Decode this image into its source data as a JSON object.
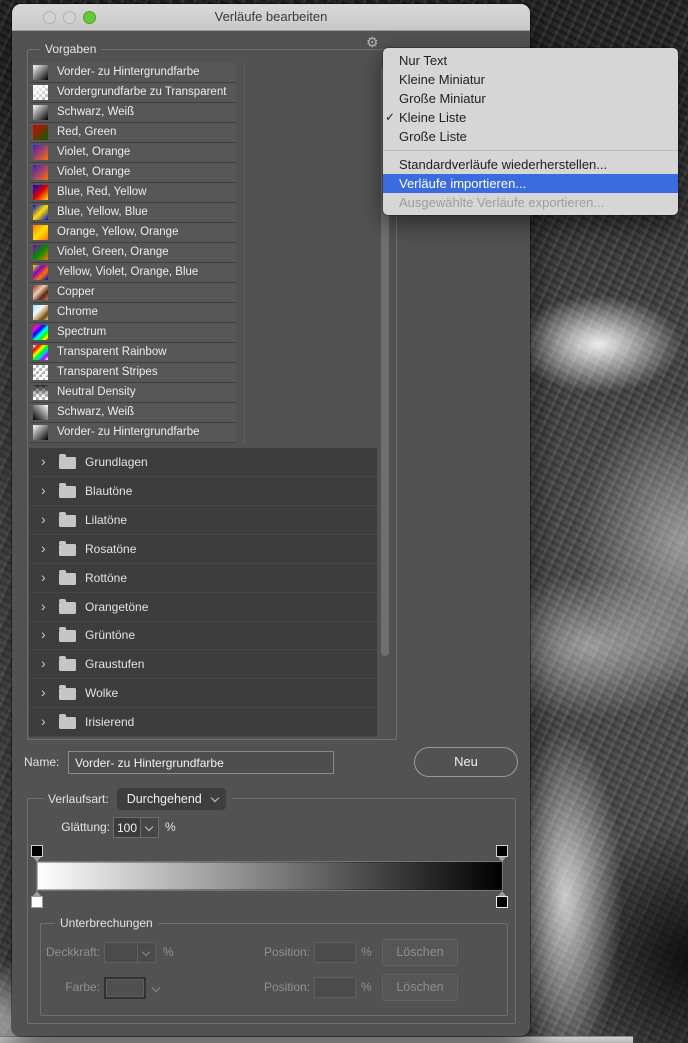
{
  "window": {
    "title": "Verläufe bearbeiten"
  },
  "presets": {
    "legend": "Vorgaben",
    "items": [
      {
        "name": "Vorder- zu Hintergrundfarbe",
        "thumb": "linear-gradient(135deg,#ffffff,#000000)",
        "transparent": false
      },
      {
        "name": "Vordergrundfarbe zu Transparent",
        "thumb": "linear-gradient(135deg,#ffffff,rgba(255,255,255,0))",
        "transparent": true
      },
      {
        "name": "Schwarz, Weiß",
        "thumb": "linear-gradient(135deg,#ffffff,#000000)",
        "transparent": false
      },
      {
        "name": "Red, Green",
        "thumb": "linear-gradient(135deg,#e00000,#006400)",
        "transparent": false
      },
      {
        "name": "Violet, Orange",
        "thumb": "linear-gradient(135deg,#4619c8,#ff7300)",
        "transparent": false
      },
      {
        "name": "Violet, Orange",
        "thumb": "linear-gradient(135deg,#4619c8,#ff7300)",
        "transparent": false
      },
      {
        "name": "Blue, Red, Yellow",
        "thumb": "linear-gradient(135deg,#0009d2,#e00000 50%,#ffe000)",
        "transparent": false
      },
      {
        "name": "Blue, Yellow, Blue",
        "thumb": "linear-gradient(135deg,#0009d2,#ffe000 50%,#0009d2)",
        "transparent": false
      },
      {
        "name": "Orange, Yellow, Orange",
        "thumb": "linear-gradient(135deg,#ff7300,#ffe000 50%,#ff7300)",
        "transparent": false
      },
      {
        "name": "Violet, Green, Orange",
        "thumb": "linear-gradient(135deg,#8800b8,#009000 50%,#ff7300)",
        "transparent": false
      },
      {
        "name": "Yellow, Violet, Orange, Blue",
        "thumb": "linear-gradient(135deg,#ffe000,#8000c0 35%,#ff7300 65%,#0009d2)",
        "transparent": false
      },
      {
        "name": "Copper",
        "thumb": "linear-gradient(135deg,#7c3a24,#f2c9ac 40%,#5a2413 70%,#c08060)",
        "transparent": false
      },
      {
        "name": "Chrome",
        "thumb": "linear-gradient(135deg,#a8e2f4,#eef9fd 38%,#caa36a 58%,#6a4a20 78%,#e6c690)",
        "transparent": false
      },
      {
        "name": "Spectrum",
        "thumb": "linear-gradient(135deg,#ff0000,#ff00ff 18%,#0000ff 38%,#00ffff 55%,#00ff00 72%,#ffff00 88%,#ff0000)",
        "transparent": false
      },
      {
        "name": "Transparent Rainbow",
        "thumb": "linear-gradient(135deg,rgba(255,0,0,0),#ff0000 22%,#ffff00 38%,#00ff00 52%,#00c8ff 66%,#b400ff 80%,rgba(180,0,255,0))",
        "transparent": true
      },
      {
        "name": "Transparent Stripes",
        "thumb": "repeating-linear-gradient(135deg,#ffffff 0px,#ffffff 2px,rgba(255,255,255,0) 2px,rgba(255,255,255,0) 5px)",
        "transparent": true
      },
      {
        "name": "Neutral Density",
        "thumb": "linear-gradient(180deg,rgba(0,0,0,0.8),rgba(0,0,0,0) 75%)",
        "transparent": true
      },
      {
        "name": "Schwarz, Weiß",
        "thumb": "linear-gradient(45deg,#000000,#ffffff)",
        "transparent": false
      },
      {
        "name": "Vorder- zu Hintergrundfarbe",
        "thumb": "linear-gradient(135deg,#ffffff,#000000)",
        "transparent": false
      }
    ],
    "folders": [
      "Grundlagen",
      "Blautöne",
      "Lilatöne",
      "Rosatöne",
      "Rottöne",
      "Orangetöne",
      "Grüntöne",
      "Graustufen",
      "Wolke",
      "Irisierend"
    ]
  },
  "context_menu": {
    "highlight_color": "#3a6ce0",
    "items": [
      {
        "label": "Nur Text"
      },
      {
        "label": "Kleine Miniatur"
      },
      {
        "label": "Große Miniatur"
      },
      {
        "label": "Kleine Liste",
        "checked": true
      },
      {
        "label": "Große Liste"
      },
      {
        "separator": true
      },
      {
        "label": "Standardverläufe wiederherstellen..."
      },
      {
        "label": "Verläufe importieren...",
        "highlighted": true
      },
      {
        "label": "Ausgewählte Verläufe exportieren...",
        "disabled": true
      }
    ]
  },
  "name_row": {
    "label": "Name:",
    "value": "Vorder- zu Hintergrundfarbe",
    "new_button": "Neu"
  },
  "gradient_section": {
    "type_label": "Verlaufsart:",
    "type_value": "Durchgehend",
    "smoothness_label": "Glättung:",
    "smoothness_value": "100",
    "percent": "%",
    "bar_gradient": "linear-gradient(90deg,#ffffff,#000000)",
    "stops": {
      "opacity_left": "#000000",
      "opacity_right": "#000000",
      "color_left": "#ffffff",
      "color_right": "#000000"
    }
  },
  "stops_section": {
    "legend": "Unterbrechungen",
    "opacity_row": {
      "label": "Deckkraft:",
      "percent": "%",
      "position_label": "Position:",
      "position_percent": "%",
      "delete_label": "Löschen"
    },
    "color_row": {
      "label": "Farbe:",
      "position_label": "Position:",
      "position_percent": "%",
      "delete_label": "Löschen"
    }
  },
  "icons": {
    "gear": "⚙",
    "folder_chevron": "›",
    "checkmark": "✓"
  }
}
